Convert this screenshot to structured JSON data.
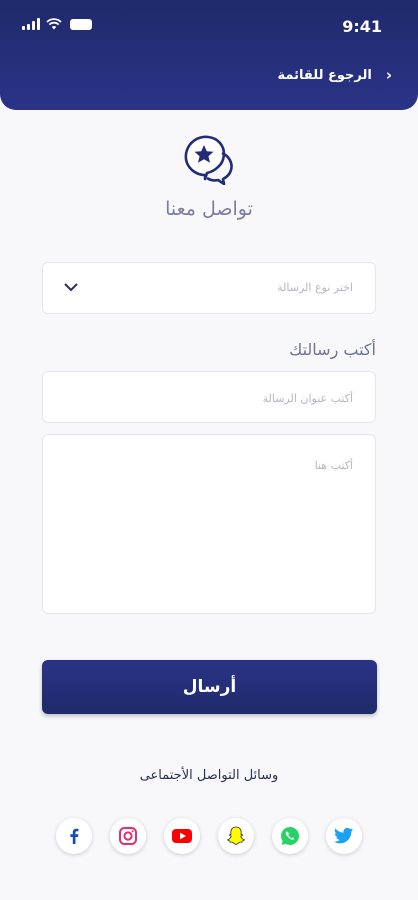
{
  "status_bar": {
    "time": "9:41"
  },
  "header": {
    "back_label": "الرجوع للقائمة",
    "back_icon": "chevron-left-icon"
  },
  "page": {
    "title": "تواصل معنا",
    "icon": "chat-star-icon"
  },
  "form": {
    "type_placeholder": "اختر نوع الرسالة",
    "section_label": "أكتب رسالتك",
    "subject_placeholder": "أكتب عنوان الرسالة",
    "message_placeholder": "أكتب هنا",
    "submit_label": "أرسال"
  },
  "social": {
    "title": "وسائل التواصل الأجتماعى",
    "items": [
      {
        "name": "facebook",
        "color": "#1a4db3"
      },
      {
        "name": "instagram",
        "color": "#e1306c"
      },
      {
        "name": "youtube",
        "color": "#ff0000"
      },
      {
        "name": "snapchat",
        "color": "#fffc00"
      },
      {
        "name": "whatsapp",
        "color": "#25d366"
      },
      {
        "name": "twitter",
        "color": "#1da1f2"
      }
    ]
  },
  "colors": {
    "primary": "#232c76",
    "background": "#f8f8fb"
  }
}
